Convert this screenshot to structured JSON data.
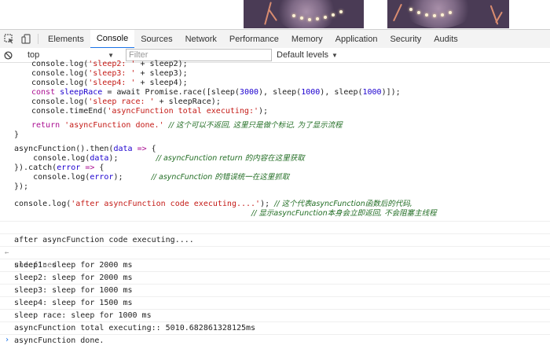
{
  "devtools_tabs": [
    "Elements",
    "Console",
    "Sources",
    "Network",
    "Performance",
    "Memory",
    "Application",
    "Security",
    "Audits"
  ],
  "active_tab": "Console",
  "toolbar": {
    "context": "top",
    "filter_placeholder": "Filter",
    "levels": "Default levels"
  },
  "code": {
    "l1": "console.log('sleep2: ' + sleep2);",
    "l2": "console.log('sleep3: ' + sleep3);",
    "l3": "console.log('sleep4: ' + sleep4);",
    "l4a": "const ",
    "l4b": "sleepRace",
    "l4c": " = await Promise.race([sleep(",
    "l4d": "3000",
    "l4e": "), sleep(",
    "l4f": "1000",
    "l4g": "), sleep(",
    "l4h": "1000",
    "l4i": ")]);",
    "l5": "console.log('sleep race: ' + sleepRace);",
    "l6": "console.timeEnd('asyncFunction total executing:');",
    "l7a": "return ",
    "l7b": "'asyncFunction done.'",
    "l7c": "  // 这个可以不返回, 这里只是做个标记, 为了显示流程",
    "l8": "}",
    "l9": "asyncFunction().then(data => {",
    "l10a": "    console.log(data);        ",
    "l10b": "// asyncFunction return 的内容在这里获取",
    "l11": "}).catch(error => {",
    "l12a": "    console.log(error);      ",
    "l12b": "// asyncFunction 的错误统一在这里抓取",
    "l13": "});",
    "l14a": "console.log(",
    "l14b": "'after asyncFunction code executing....'",
    "l14c": "); ",
    "l14d": "// 这个代表asyncFunction函数后的代码,",
    "l15": "// 显示asyncFunction本身会立即返回, 不会阻塞主线程"
  },
  "output": [
    "after asyncFunction code executing....",
    "undefined",
    "sleep1: sleep for 2000 ms",
    "sleep2: sleep for 2000 ms",
    "sleep3: sleep for 1000 ms",
    "sleep4: sleep for 1500 ms",
    "sleep race: sleep for 1000 ms",
    "asyncFunction total executing:: 5010.682861328125ms",
    "asyncFunction done."
  ],
  "colors": {
    "keyword": "#aa0d91",
    "string": "#c41a16",
    "comment": "#236e25",
    "active_tab_underline": "#1a73e8"
  },
  "icons": [
    "inspect-element-icon",
    "device-toggle-icon",
    "clear-console-icon",
    "dropdown-arrow-icon",
    "return-arrow-icon",
    "prompt-icon"
  ]
}
